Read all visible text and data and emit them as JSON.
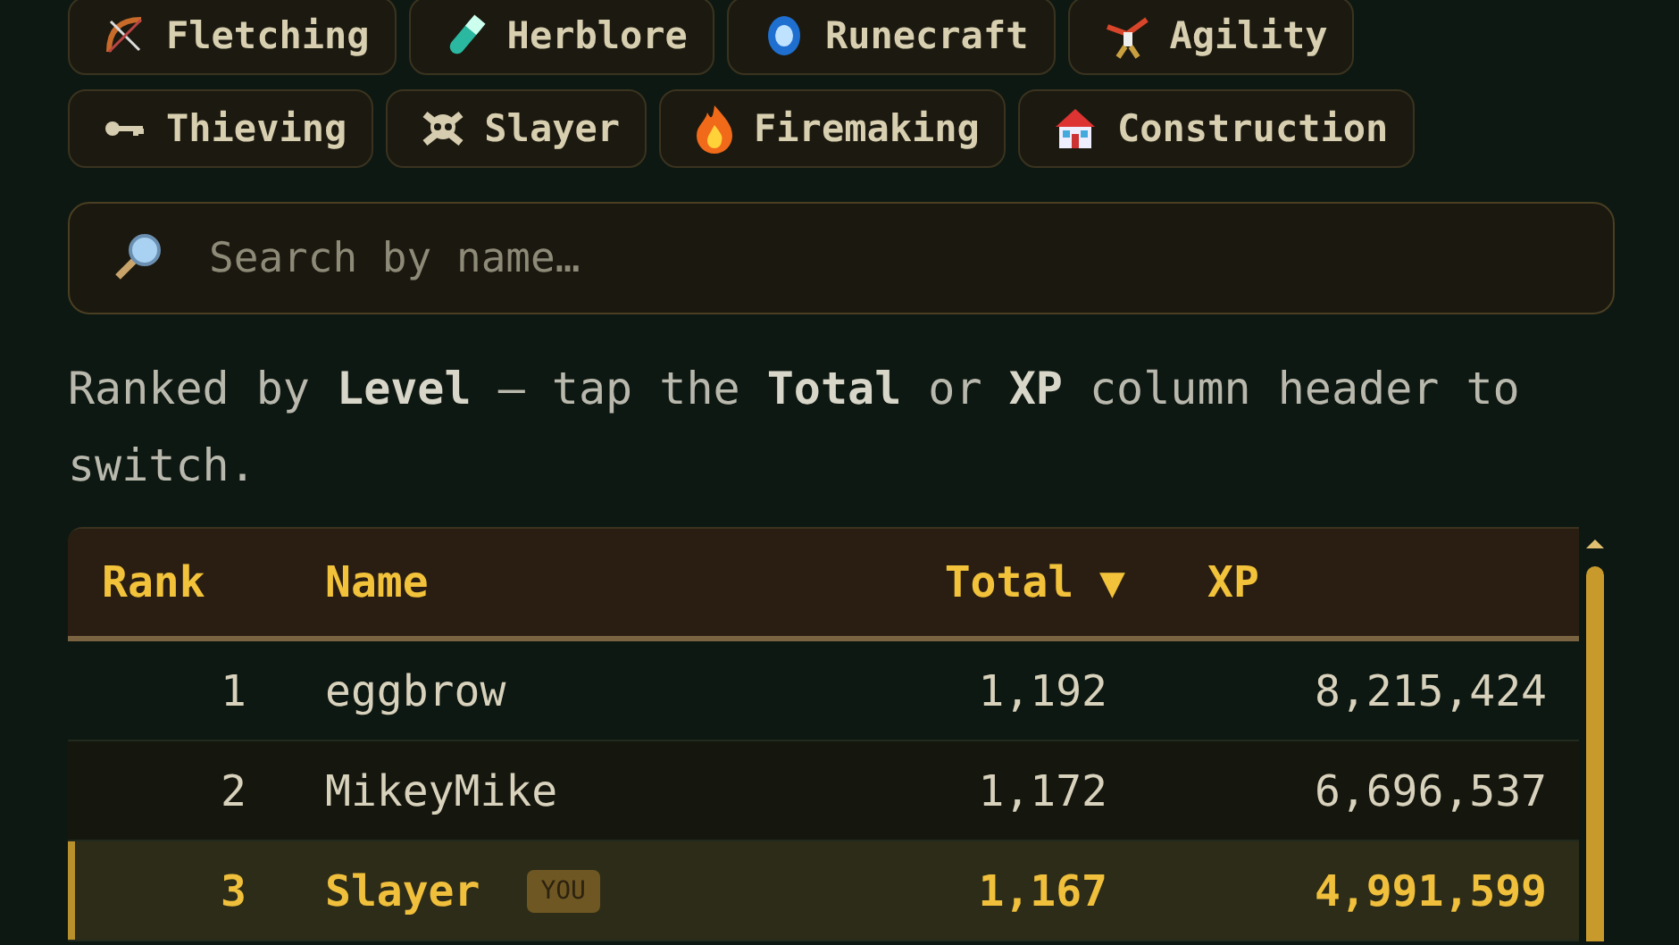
{
  "skills": [
    {
      "label": "Fletching"
    },
    {
      "label": "Herblore"
    },
    {
      "label": "Runecraft"
    },
    {
      "label": "Agility"
    },
    {
      "label": "Thieving"
    },
    {
      "label": "Slayer"
    },
    {
      "label": "Firemaking"
    },
    {
      "label": "Construction"
    }
  ],
  "search": {
    "placeholder": "Search by name…"
  },
  "hint": "Ranked by **Level** — tap the **Total** or **XP** column header to switch.",
  "table": {
    "columns": [
      {
        "label": "Rank"
      },
      {
        "label": "Name"
      },
      {
        "label": "Total",
        "sort_indicator": "▼"
      },
      {
        "label": "XP"
      }
    ],
    "rows": [
      {
        "rank": "1",
        "name": "eggbrow",
        "total": "1,192",
        "xp": "8,215,424",
        "current": false
      },
      {
        "rank": "2",
        "name": "MikeyMike",
        "total": "1,172",
        "xp": "6,696,537",
        "current": false
      },
      {
        "rank": "3",
        "name": "Slayer",
        "badge": "YOU",
        "total": "1,167",
        "xp": "4,991,599",
        "current": true
      }
    ]
  }
}
